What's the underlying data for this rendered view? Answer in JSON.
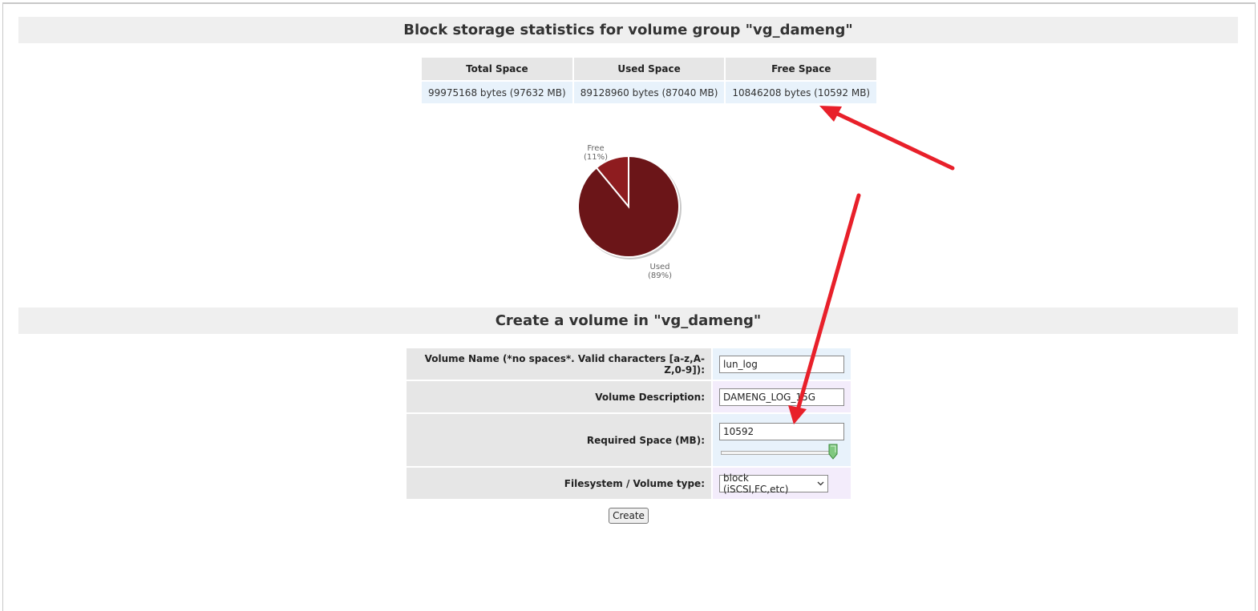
{
  "stats": {
    "title": "Block storage statistics for volume group \"vg_dameng\"",
    "columns": [
      "Total Space",
      "Used Space",
      "Free Space"
    ],
    "values": [
      "99975168 bytes (97632 MB)",
      "89128960 bytes (87040 MB)",
      "10846208 bytes (10592 MB)"
    ]
  },
  "pie": {
    "free_label": "Free",
    "free_pct": "(11%)",
    "used_label": "Used",
    "used_pct": "(89%)",
    "colors": {
      "used": "#6b1518",
      "free": "#8e1c1f"
    }
  },
  "chart_data": {
    "type": "pie",
    "categories": [
      "Free",
      "Used"
    ],
    "values": [
      11,
      89
    ]
  },
  "create": {
    "title": "Create a volume in \"vg_dameng\"",
    "name_label": "Volume Name (*no spaces*. Valid characters [a-z,A-Z,0-9]):",
    "name_value": "lun_log",
    "desc_label": "Volume Description:",
    "desc_value": "DAMENG_LOG_15G",
    "space_label": "Required Space (MB):",
    "space_value": "10592",
    "space_slider_fraction": 1.0,
    "fs_label": "Filesystem / Volume type:",
    "fs_value": "block (iSCSI,FC,etc)",
    "button_label": "Create"
  },
  "annotation_color": "#e8202a"
}
